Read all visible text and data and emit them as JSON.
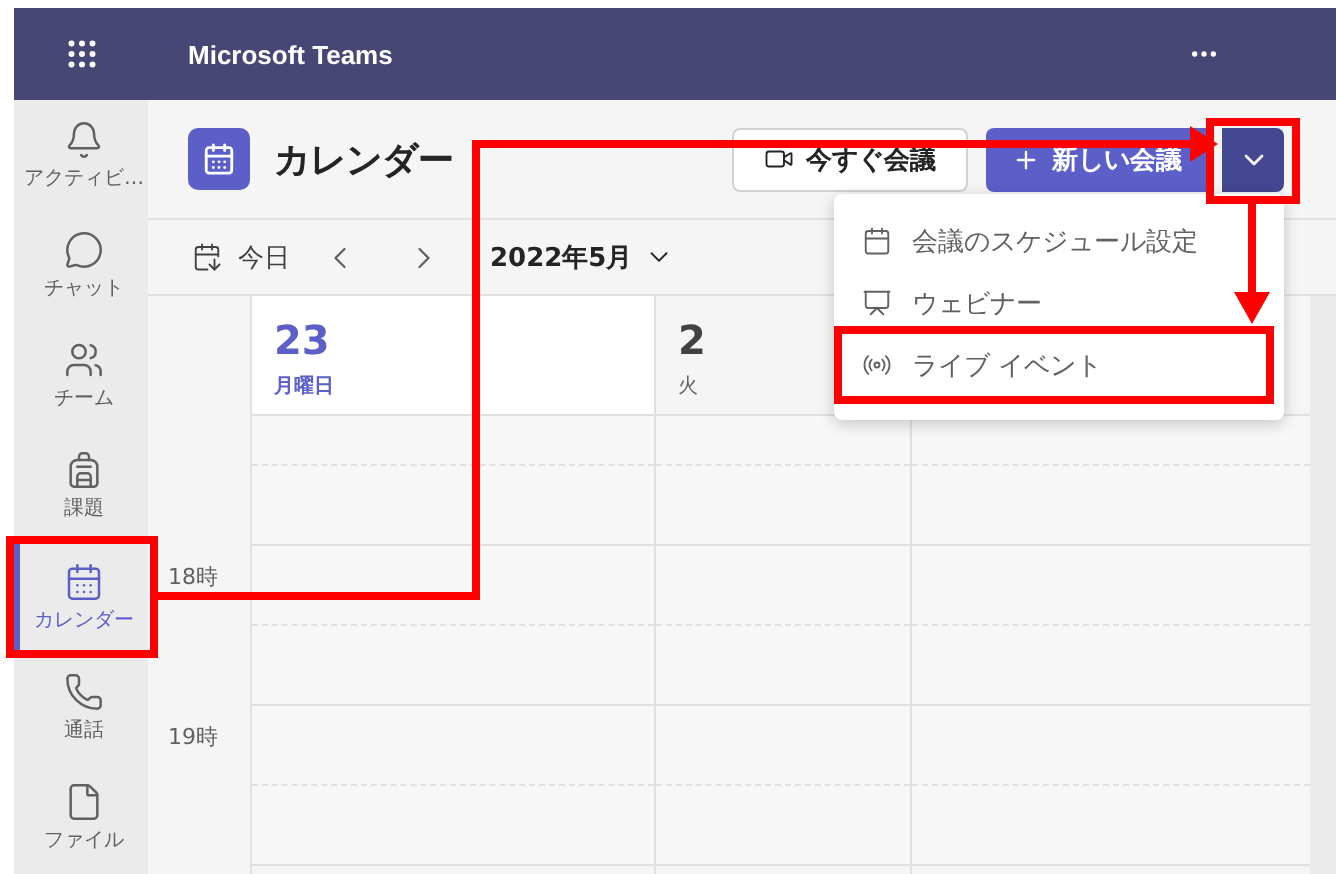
{
  "app": {
    "title": "Microsoft Teams"
  },
  "rail": [
    {
      "label": "アクティビ…",
      "kind": "bell",
      "selected": false
    },
    {
      "label": "チャット",
      "kind": "chat",
      "selected": false
    },
    {
      "label": "チーム",
      "kind": "team",
      "selected": false
    },
    {
      "label": "課題",
      "kind": "backpack",
      "selected": false
    },
    {
      "label": "カレンダー",
      "kind": "calendar",
      "selected": true
    },
    {
      "label": "通話",
      "kind": "phone",
      "selected": false
    },
    {
      "label": "ファイル",
      "kind": "file",
      "selected": false
    }
  ],
  "header": {
    "title": "カレンダー",
    "meet_now": "今すぐ会議",
    "new_meeting": "新しい会議"
  },
  "toolbar": {
    "today": "今日",
    "month": "2022年5月"
  },
  "days": [
    {
      "date": "23",
      "weekday": "月曜日",
      "selected": true
    },
    {
      "date": "2",
      "weekday": "火",
      "selected": false
    }
  ],
  "hours": [
    "18時",
    "19時"
  ],
  "menu": [
    {
      "label": "会議のスケジュール設定",
      "kind": "calendar",
      "highlighted": false
    },
    {
      "label": "ウェビナー",
      "kind": "webinar",
      "highlighted": false
    },
    {
      "label": "ライブ イベント",
      "kind": "live",
      "highlighted": true
    }
  ]
}
